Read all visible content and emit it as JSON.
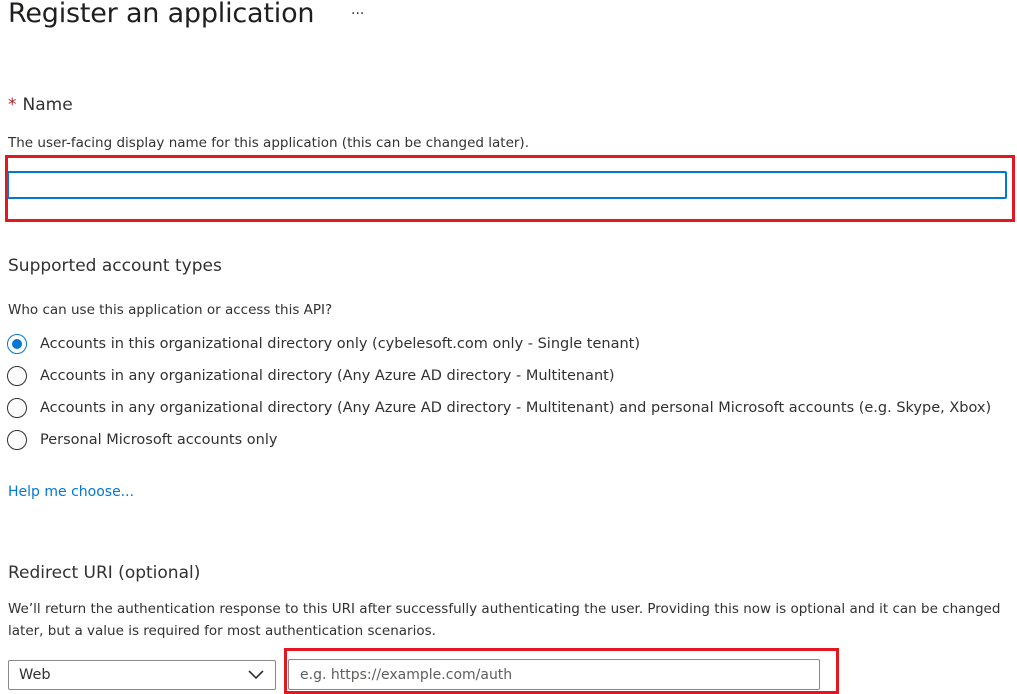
{
  "header": {
    "title": "Register an application",
    "more_label": "···"
  },
  "name_section": {
    "required_marker": "*",
    "label": "Name",
    "description": "The user-facing display name for this application (this can be changed later).",
    "value": "",
    "focus_color": "#0078d4"
  },
  "account_types": {
    "heading": "Supported account types",
    "question": "Who can use this application or access this API?",
    "options": [
      {
        "label": "Accounts in this organizational directory only (cybelesoft.com only - Single tenant)",
        "selected": true
      },
      {
        "label": "Accounts in any organizational directory (Any Azure AD directory - Multitenant)",
        "selected": false
      },
      {
        "label": "Accounts in any organizational directory (Any Azure AD directory - Multitenant) and personal Microsoft accounts (e.g. Skype, Xbox)",
        "selected": false
      },
      {
        "label": "Personal Microsoft accounts only",
        "selected": false
      }
    ],
    "help_link": "Help me choose..."
  },
  "redirect": {
    "heading": "Redirect URI (optional)",
    "description": "We’ll return the authentication response to this URI after successfully authenticating the user. Providing this now is optional and it can be changed later, but a value is required for most authentication scenarios.",
    "platform_selected": "Web",
    "uri_placeholder": "e.g. https://example.com/auth",
    "uri_value": ""
  },
  "colors": {
    "accent": "#0078d4",
    "highlight_box": "#e3171f",
    "required": "#a4262c",
    "link": "#0078d4"
  },
  "icons": {
    "chevron": "chevron-down-icon",
    "more": "more-icon"
  }
}
